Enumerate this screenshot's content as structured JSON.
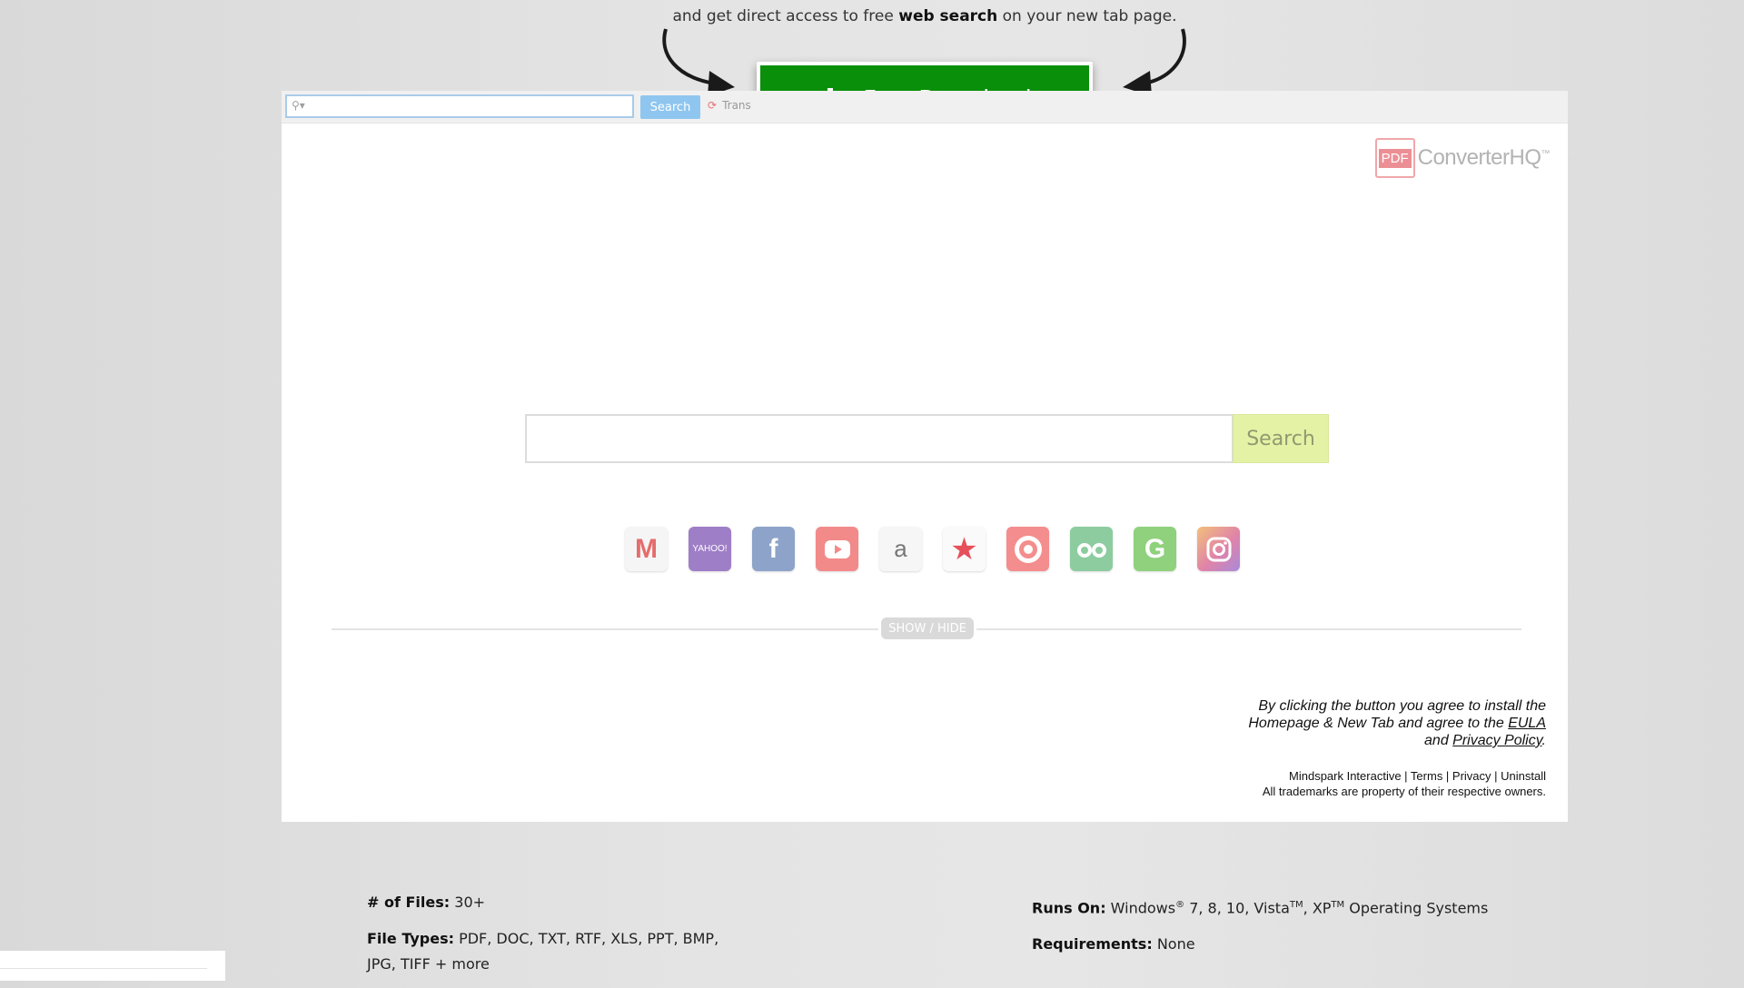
{
  "promo": {
    "tagline_pre": "and get direct access to free ",
    "tagline_bold": "web search",
    "tagline_post": " on your new tab page.",
    "download_label": "Free Download"
  },
  "toolbar": {
    "search_placeholder": "",
    "search_button": "Search",
    "translate_label": "Trans"
  },
  "logo": {
    "pdf": "PDF",
    "name": "ConverterHQ",
    "tm": "™"
  },
  "main_search": {
    "placeholder": "",
    "button": "Search"
  },
  "tiles": [
    {
      "name": "gmail-icon",
      "glyph": "M"
    },
    {
      "name": "yahoo-icon",
      "glyph": "YAHOO!"
    },
    {
      "name": "facebook-icon",
      "glyph": "f"
    },
    {
      "name": "youtube-icon",
      "glyph": ""
    },
    {
      "name": "amazon-icon",
      "glyph": "a"
    },
    {
      "name": "macys-star-icon",
      "glyph": "★"
    },
    {
      "name": "target-icon",
      "glyph": ""
    },
    {
      "name": "tripadvisor-icon",
      "glyph": ""
    },
    {
      "name": "grammarly-icon",
      "glyph": "G"
    },
    {
      "name": "instagram-icon",
      "glyph": ""
    }
  ],
  "showhide_label": "SHOW / HIDE",
  "agreement": {
    "line1": "By clicking the button you agree to install the",
    "line2_pre": "Homepage & New Tab and agree to the ",
    "eula": "EULA",
    "line3_pre": "and ",
    "privacy": "Privacy Policy",
    "line3_post": "."
  },
  "footer_links": {
    "text": "Mindspark Interactive | Terms | Privacy | Uninstall",
    "trademarks": "All trademarks are property of their respective owners."
  },
  "specs": {
    "files_label": "# of Files:",
    "files_value": " 30+",
    "types_label": "File Types:",
    "types_value": " PDF, DOC, TXT, RTF, XLS, PPT, BMP, JPG, TIFF + more",
    "runs_label": "Runs On:",
    "runs_value_1": " Windows",
    "runs_sup_1": "®",
    "runs_value_2": " 7, 8, 10, Vista",
    "runs_sup_2": "TM",
    "runs_value_3": ", XP",
    "runs_sup_3": "TM",
    "runs_value_4": " Operating Systems",
    "req_label": "Requirements:",
    "req_value": " None"
  },
  "colors": {
    "download_green": "#0a8f0a",
    "search_btn": "#e4f2a6"
  }
}
